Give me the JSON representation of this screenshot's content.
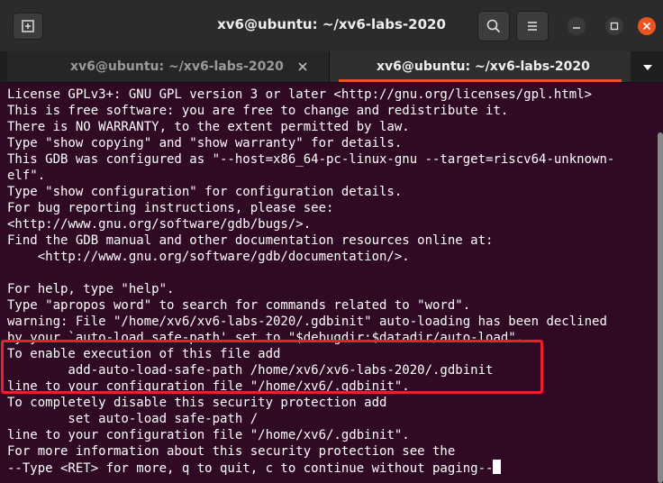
{
  "window": {
    "title": "xv6@ubuntu: ~/xv6-labs-2020"
  },
  "tabs": [
    {
      "label": "xv6@ubuntu: ~/xv6-labs-2020",
      "active": false
    },
    {
      "label": "xv6@ubuntu: ~/xv6-labs-2020",
      "active": true
    }
  ],
  "icons": {
    "new_tab": "new-tab-icon",
    "search": "search-icon",
    "menu": "hamburger-menu-icon",
    "minimize": "minimize-icon",
    "maximize": "maximize-icon",
    "close": "close-icon"
  },
  "colors": {
    "terminal_bg": "#300a24",
    "accent": "#e95420",
    "highlight": "#e8202a"
  },
  "terminal": {
    "lines": [
      "License GPLv3+: GNU GPL version 3 or later <http://gnu.org/licenses/gpl.html>",
      "This is free software: you are free to change and redistribute it.",
      "There is NO WARRANTY, to the extent permitted by law.",
      "Type \"show copying\" and \"show warranty\" for details.",
      "This GDB was configured as \"--host=x86_64-pc-linux-gnu --target=riscv64-unknown-",
      "elf\".",
      "Type \"show configuration\" for configuration details.",
      "For bug reporting instructions, please see:",
      "<http://www.gnu.org/software/gdb/bugs/>.",
      "Find the GDB manual and other documentation resources online at:",
      "    <http://www.gnu.org/software/gdb/documentation/>.",
      "",
      "For help, type \"help\".",
      "Type \"apropos word\" to search for commands related to \"word\".",
      "warning: File \"/home/xv6/xv6-labs-2020/.gdbinit\" auto-loading has been declined",
      "by your `auto-load safe-path' set to \"$debugdir:$datadir/auto-load\".",
      "To enable execution of this file add",
      "        add-auto-load-safe-path /home/xv6/xv6-labs-2020/.gdbinit",
      "line to your configuration file \"/home/xv6/.gdbinit\".",
      "To completely disable this security protection add",
      "        set auto-load safe-path /",
      "line to your configuration file \"/home/xv6/.gdbinit\".",
      "For more information about this security protection see the",
      "--Type <RET> for more, q to quit, c to continue without paging--"
    ]
  }
}
